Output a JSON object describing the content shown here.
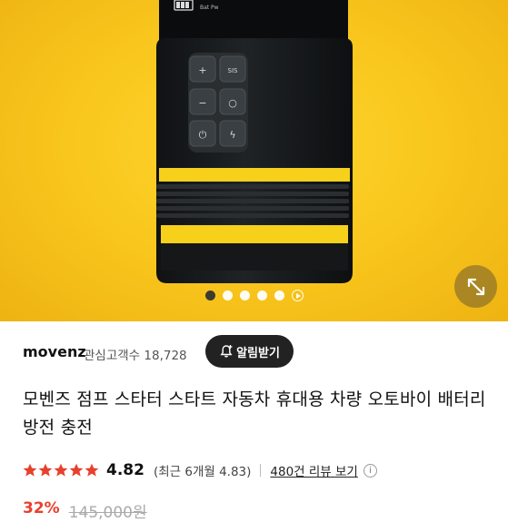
{
  "seller": {
    "name": "movenz",
    "follower_label": "관심고객수 18,728",
    "notify_label": "알림받기"
  },
  "product": {
    "title": "모벤즈 점프 스타터 스타트 자동차 휴대용 차량 오토바이 배터리 방전 충전"
  },
  "rating": {
    "stars": 4.82,
    "score": "4.82",
    "recent": "(최근 6개월 4.83)",
    "reviews_link": "480건 리뷰 보기",
    "star_color": "#e8402d"
  },
  "price": {
    "discount": "32%",
    "original": "145,000원"
  },
  "gallery": {
    "total_images": 5,
    "current_index": 1,
    "has_video": true,
    "background_color": "#f8c51c"
  },
  "device_screen_text": "Bat Pw"
}
